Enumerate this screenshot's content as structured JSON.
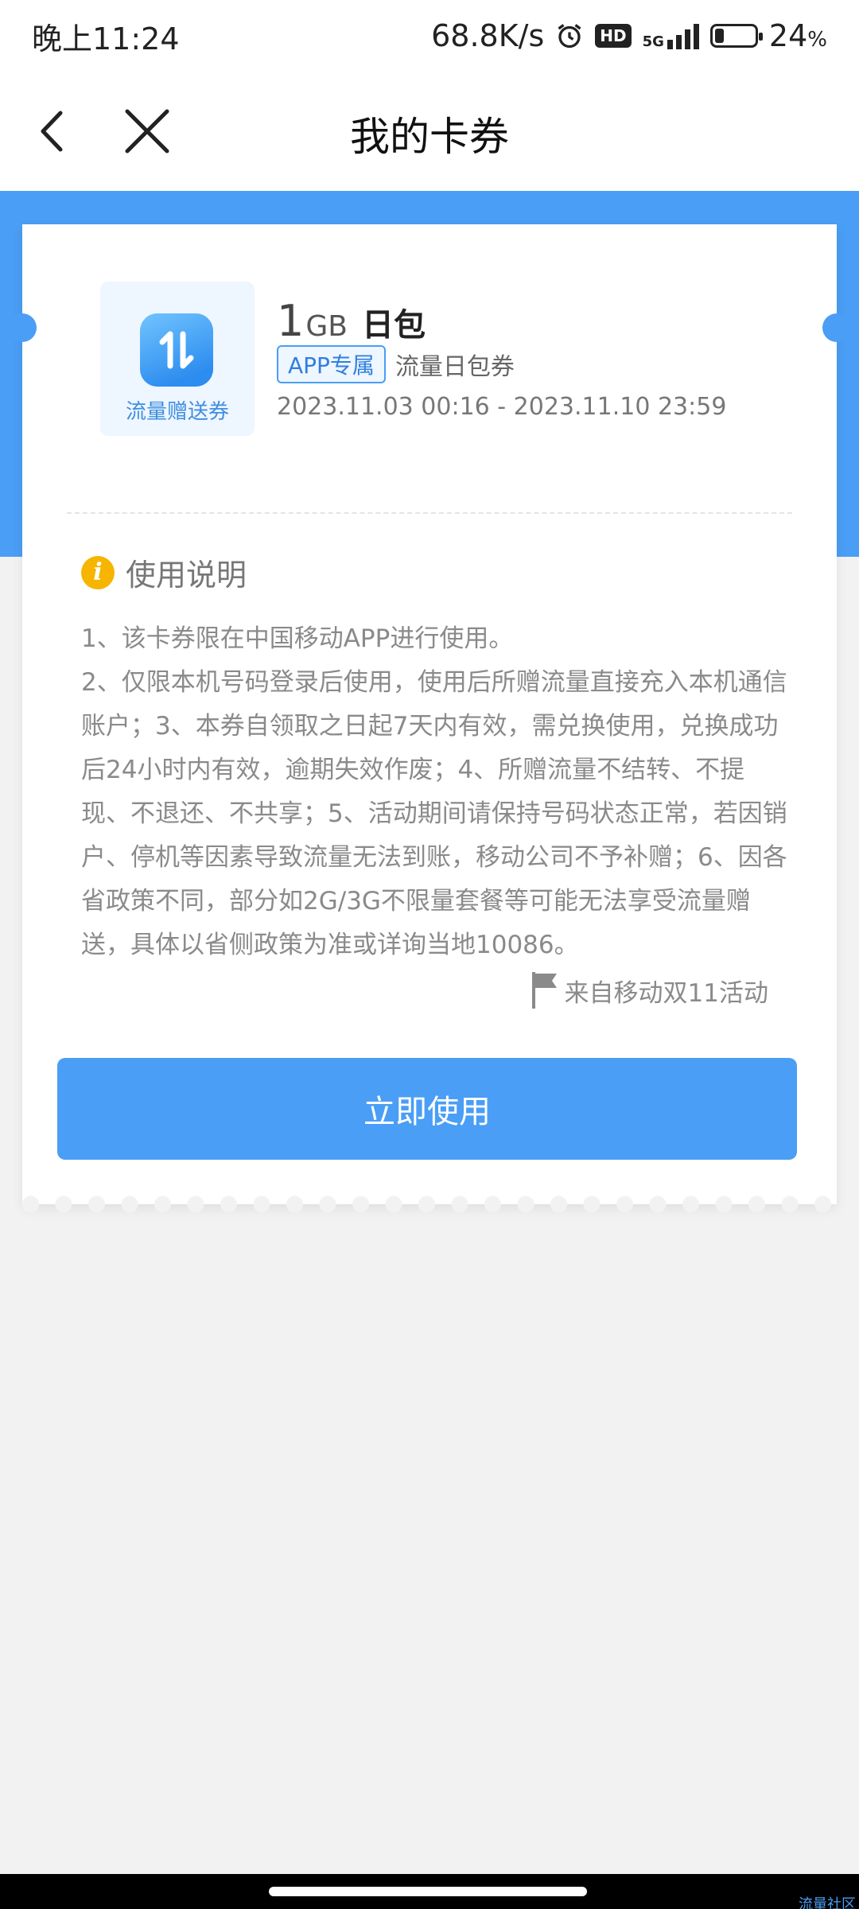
{
  "status_bar": {
    "time": "晚上11:24",
    "network_speed": "68.8K/s",
    "alarm_icon": "alarm-clock-icon",
    "hd_label": "HD",
    "network_type": "5G",
    "battery_percent": "24",
    "battery_unit": "%",
    "battery_level": 0.24
  },
  "nav": {
    "title": "我的卡券",
    "back_icon": "chevron-left-icon",
    "close_icon": "close-icon"
  },
  "coupon": {
    "thumb_label": "流量赠送券",
    "thumb_icon": "data-transfer-icon",
    "amount": "1",
    "unit": "GB",
    "name": "日包",
    "tag": "APP专属",
    "type": "流量日包券",
    "validity": "2023.11.03 00:16 - 2023.11.10 23:59"
  },
  "instructions": {
    "title": "使用说明",
    "lines": [
      "1、该卡券限在中国移动APP进行使用。",
      "2、仅限本机号码登录后使用，使用后所赠流量直接充入本机通信账户；3、本券自领取之日起7天内有效，需兑换使用，兑换成功后24小时内有效，逾期失效作废；4、所赠流量不结转、不提现、不退还、不共享；5、活动期间请保持号码状态正常，若因销户、停机等因素导致流量无法到账，移动公司不予补赠；6、因各省政策不同，部分如2G/3G不限量套餐等可能无法享受流量赠送，具体以省侧政策为准或详询当地10086。"
    ],
    "source": "来自移动双11活动"
  },
  "action": {
    "use_label": "立即使用"
  },
  "watermark": "流量社区",
  "colors": {
    "brand_blue": "#4a9ef5",
    "warning_yellow": "#f6b500",
    "background": "#f2f2f2"
  }
}
